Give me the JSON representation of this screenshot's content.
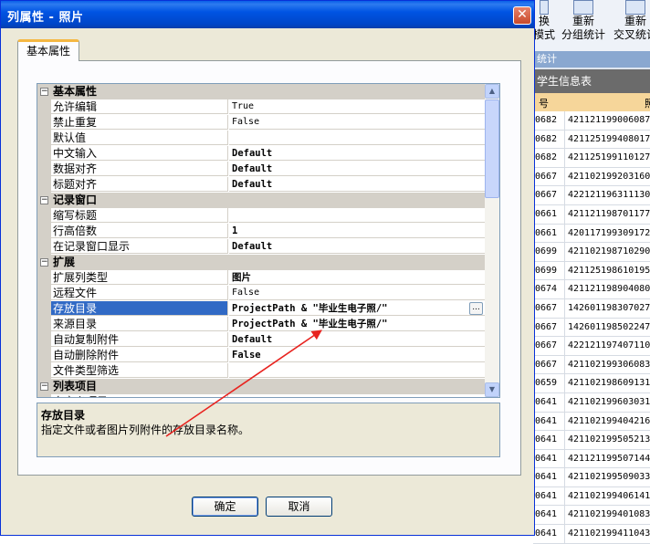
{
  "background_app": {
    "ribbon_buttons": [
      {
        "line1": "换",
        "line2": "模式"
      },
      {
        "line1": "重新",
        "line2": "分组统计"
      },
      {
        "line1": "重新",
        "line2": "交叉统计"
      }
    ],
    "group_label": "统计",
    "table_title": "学生信息表",
    "column_headers": [
      "号",
      "照"
    ],
    "rows": [
      [
        "0682",
        "421121199006087"
      ],
      [
        "0682",
        "421125199408017"
      ],
      [
        "0682",
        "421125199110127"
      ],
      [
        "0667",
        "421102199203160"
      ],
      [
        "0667",
        "422121196311130"
      ],
      [
        "0661",
        "421121198701177"
      ],
      [
        "0661",
        "420117199309172"
      ],
      [
        "0699",
        "421102198710290"
      ],
      [
        "0699",
        "421125198610195"
      ],
      [
        "0674",
        "421121198904080"
      ],
      [
        "0667",
        "142601198307027"
      ],
      [
        "0667",
        "142601198502247"
      ],
      [
        "0667",
        "422121197407110"
      ],
      [
        "0667",
        "421102199306083"
      ],
      [
        "0659",
        "421102198609131"
      ],
      [
        "0641",
        "421102199603031"
      ],
      [
        "0641",
        "421102199404216"
      ],
      [
        "0641",
        "421102199505213"
      ],
      [
        "0641",
        "421121199507144"
      ],
      [
        "0641",
        "421102199509033"
      ],
      [
        "0641",
        "421102199406141"
      ],
      [
        "0641",
        "421102199401083"
      ],
      [
        "0641",
        "421102199411043"
      ]
    ]
  },
  "dialog": {
    "title": "列属性 - 照片",
    "close_glyph": "✕",
    "tab_label": "基本属性",
    "categories": [
      {
        "name": "基本属性",
        "expander": "−",
        "items": [
          {
            "name": "允许编辑",
            "value": "True",
            "bold": false
          },
          {
            "name": "禁止重复",
            "value": "False",
            "bold": false
          },
          {
            "name": "默认值",
            "value": "",
            "bold": false
          },
          {
            "name": "中文输入",
            "value": "Default",
            "bold": true
          },
          {
            "name": "数据对齐",
            "value": "Default",
            "bold": true
          },
          {
            "name": "标题对齐",
            "value": "Default",
            "bold": true
          }
        ]
      },
      {
        "name": "记录窗口",
        "expander": "−",
        "items": [
          {
            "name": "缩写标题",
            "value": "",
            "bold": false
          },
          {
            "name": "行高倍数",
            "value": "1",
            "bold": true
          },
          {
            "name": "在记录窗口显示",
            "value": "Default",
            "bold": true
          }
        ]
      },
      {
        "name": "扩展",
        "expander": "−",
        "items": [
          {
            "name": "扩展列类型",
            "value": "图片",
            "bold": true
          },
          {
            "name": "远程文件",
            "value": "False",
            "bold": false
          },
          {
            "name": "存放目录",
            "value": "ProjectPath & \"毕业生电子照/\"",
            "bold": true,
            "selected": true
          },
          {
            "name": "来源目录",
            "value": "ProjectPath & \"毕业生电子照/\"",
            "bold": true
          },
          {
            "name": "自动复制附件",
            "value": "Default",
            "bold": true
          },
          {
            "name": "自动删除附件",
            "value": "False",
            "bold": true
          },
          {
            "name": "文件类型筛选",
            "value": "",
            "bold": false
          }
        ]
      },
      {
        "name": "列表项目",
        "expander": "−",
        "items": [
          {
            "name": "自定义项目",
            "value": "",
            "bold": false
          }
        ]
      }
    ],
    "ellipsis_label": "...",
    "scroll_up": "▲",
    "scroll_down": "▼",
    "description_title": "存放目录",
    "description_text": "指定文件或者图片列附件的存放目录名称。",
    "ok_label": "确定",
    "cancel_label": "取消",
    "arrow_color": "#e8231f"
  }
}
